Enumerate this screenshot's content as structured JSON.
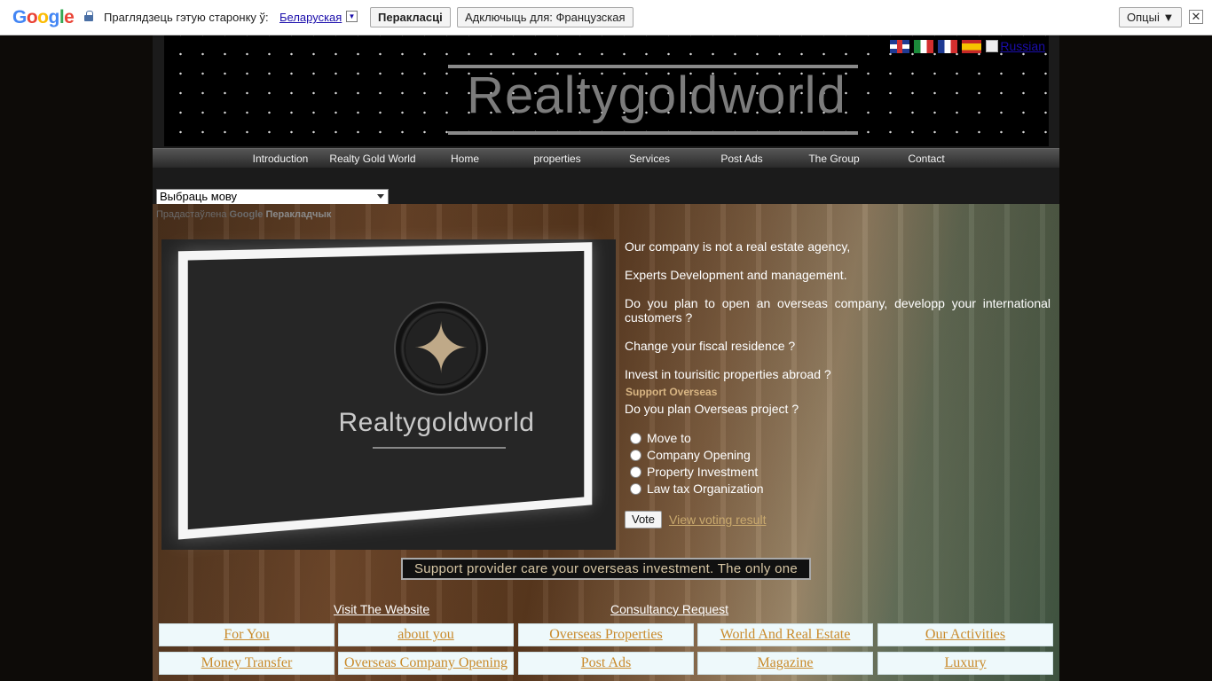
{
  "translate_bar": {
    "logo_letters": [
      "G",
      "o",
      "o",
      "g",
      "l",
      "e"
    ],
    "prompt": "Праглядзець гэтую старонку ў:",
    "language": "Беларуская",
    "dropdown_arrow": "▼",
    "translate_label": "Перакласці",
    "disable_label": "Адключыць для: Французская",
    "options_label": "Опцыі ▼",
    "close_glyph": "✕"
  },
  "header": {
    "logo_text": "Realtygoldworld",
    "flag_names": [
      "uk-flag-icon",
      "italy-flag-icon",
      "france-flag-icon",
      "spain-flag-icon"
    ],
    "russian_alt": "Russian"
  },
  "nav": {
    "items": [
      "Introduction",
      "Realty Gold World",
      "Home",
      "properties",
      "Services",
      "Post Ads",
      "The Group",
      "Contact"
    ]
  },
  "language_widget": {
    "select_value": "Выбраць мову",
    "powered_prefix": "Прадастаўлена",
    "powered_google": "Google",
    "powered_product": "Перакладчык"
  },
  "intro_image": {
    "logo_text": "Realtygoldworld"
  },
  "intro_text": {
    "paragraphs": [
      "Our company is not a real estate agency,",
      "Experts Development and management.",
      "Do you plan to open an overseas company, developp your international customers ?",
      "Change your fiscal residence ?",
      "Invest in tourisitic properties abroad ?"
    ]
  },
  "poll": {
    "title": "Support Overseas",
    "question": "Do you plan Overseas project ?",
    "options": [
      "Move to",
      "Company Opening",
      "Property Investment",
      "Law tax Organization"
    ],
    "vote_label": "Vote",
    "results_link": "View voting result"
  },
  "ticker": {
    "text": "Support provider care your overseas investment. The only one"
  },
  "links": {
    "visit": "Visit The Website",
    "consultancy": "Consultancy Request"
  },
  "grid": {
    "row1": [
      "For You",
      "about you",
      "Overseas Properties",
      "World And Real Estate",
      "Our Activities"
    ],
    "row2": [
      "Money Transfer",
      "Overseas Company Opening",
      "Post Ads",
      "Magazine",
      "Luxury"
    ]
  },
  "colors": {
    "accent_link": "#c98a2b",
    "poll_title": "#d8b583",
    "nav_bg": "#3a3a3a"
  }
}
